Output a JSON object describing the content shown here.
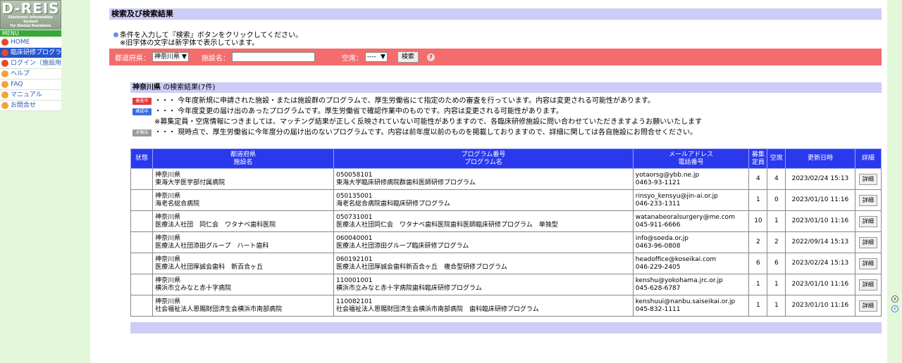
{
  "logo": {
    "title": "D-REIS",
    "subtitle": [
      "Electronic Information",
      "System",
      "for Dental Residents"
    ]
  },
  "menu_label": "MENU",
  "menu": [
    {
      "label": "HOME",
      "icon": "home-icon",
      "color": "#e24b2c"
    },
    {
      "label": "臨床研修プログラム閲覧",
      "icon": "search-icon",
      "color": "#e24b2c"
    },
    {
      "label": "ログイン（施設用）",
      "icon": "login-icon",
      "color": "#e24b2c"
    },
    {
      "label": "ヘルプ",
      "icon": "help-icon",
      "color": "#f2a43a"
    },
    {
      "label": "FAQ",
      "icon": "faq-icon",
      "color": "#f2a43a"
    },
    {
      "label": "マニュアル",
      "icon": "manual-icon",
      "color": "#f2a43a"
    },
    {
      "label": "お問合せ",
      "icon": "contact-icon",
      "color": "#f2a43a"
    }
  ],
  "page_title": "検索及び検索結果",
  "instructions": [
    "条件を入力して『検索』ボタンをクリックしてください。",
    "※旧字体の文字は新字体で表示しています。"
  ],
  "search": {
    "pref_label": "都道府県：",
    "pref_value": "神奈川県",
    "facility_label": "施設名：",
    "facility_value": "",
    "vacancy_label": "空席：",
    "vacancy_value": "----",
    "search_button": "検索",
    "help_icon": "?"
  },
  "result": {
    "pref": "神奈川県",
    "summary": "の検索結果(7件)"
  },
  "legend": [
    {
      "badge": "審査中",
      "color": "#e23a3a",
      "text": "・・・ 今年度新規に申請された施設・または施設群のプログラムで、厚生労働省にて指定のための審査を行っています。内容は変更される可能性があります。"
    },
    {
      "badge": "確認中",
      "color": "#3a6ee2",
      "text": "・・・ 今年度変更の届け出のあったプログラムです。厚生労働省で確認作業中のものです。内容は変更される可能性があります。"
    },
    {
      "badge": "",
      "color": "",
      "text": "※募集定員・空席情報につきましては、マッチング結果が正しく反映されていない可能性がありますので、各臨床研修施設に問い合わせていただきますようお願いいたします"
    },
    {
      "badge": "未報告",
      "color": "#9a9a9a",
      "text": "・・・ 現時点で、厚生労働省に今年度分の届け出のないプログラムです。内容は前年度以前のものを掲載しておりますので、詳細に関しては各自施設にお問合せください。"
    }
  ],
  "table": {
    "headers": {
      "status": "状態",
      "pref_facility": [
        "都道府県",
        "施設名"
      ],
      "program": [
        "プログラム番号",
        "プログラム名"
      ],
      "contact": [
        "メールアドレス",
        "電話番号"
      ],
      "capacity": [
        "募集",
        "定員"
      ],
      "vacancy": "空席",
      "updated": "更新日時",
      "detail": "詳細"
    },
    "rows": [
      {
        "pref": "神奈川県",
        "facility": "東海大学医学部付属病院",
        "program_no": "050058101",
        "program_name": "東海大学臨床研修病院群歯科医師研修プログラム",
        "email": "yotaorsg@ybb.ne.jp",
        "phone": "0463-93-1121",
        "capacity": "4",
        "vacancy": "4",
        "updated": "2023/02/24 15:13",
        "detail": "詳細"
      },
      {
        "pref": "神奈川県",
        "facility": "海老名総合病院",
        "program_no": "050135001",
        "program_name": "海老名総合病院歯科臨床研修プログラム",
        "email": "rinsyo_kensyu@jin-ai.or.jp",
        "phone": "046-233-1311",
        "capacity": "1",
        "vacancy": "0",
        "updated": "2023/01/10 11:16",
        "detail": "詳細"
      },
      {
        "pref": "神奈川県",
        "facility": "医療法人社団　同仁会　ワタナベ歯科医院",
        "program_no": "050731001",
        "program_name": "医療法人社団同仁会　ワタナベ歯科医院歯科医師臨床研修プログラム　単独型",
        "email": "watanabeoralsurgery@me.com",
        "phone": "045-911-6666",
        "capacity": "10",
        "vacancy": "1",
        "updated": "2023/01/10 11:16",
        "detail": "詳細"
      },
      {
        "pref": "神奈川県",
        "facility": "医療法人社団添田グループ　ハート歯科",
        "program_no": "060040001",
        "program_name": "医療法人社団添田グループ臨床研修プログラム",
        "email": "info@soeda.or.jp",
        "phone": "0463-96-0808",
        "capacity": "2",
        "vacancy": "2",
        "updated": "2022/09/14 15:13",
        "detail": "詳細"
      },
      {
        "pref": "神奈川県",
        "facility": "医療法人社団厚誠会歯科　新百合ヶ丘",
        "program_no": "060192101",
        "program_name": "医療法人社団厚誠会歯科新百合ヶ丘　複合型研修プログラム",
        "email": "headoffice@koseikai.com",
        "phone": "046-229-2405",
        "capacity": "6",
        "vacancy": "6",
        "updated": "2023/02/24 15:13",
        "detail": "詳細"
      },
      {
        "pref": "神奈川県",
        "facility": "横浜市立みなと赤十字病院",
        "program_no": "110001001",
        "program_name": "横浜市立みなと赤十字病院歯科臨床研修プログラム",
        "email": "kenshu@yokohama.jrc.or.jp",
        "phone": "045-628-6787",
        "capacity": "1",
        "vacancy": "1",
        "updated": "2023/01/10 11:16",
        "detail": "詳細"
      },
      {
        "pref": "神奈川県",
        "facility": "社会福祉法人恩賜財団済生会横浜市南部病院",
        "program_no": "110082101",
        "program_name": "社会福祉法人恩賜財団済生会横浜市南部病院　歯科臨床研修プログラム",
        "email": "kenshuui@nanbu.saiseikai.or.jp",
        "phone": "045-832-1111",
        "capacity": "1",
        "vacancy": "1",
        "updated": "2023/01/10 11:16",
        "detail": "詳細"
      }
    ]
  },
  "colors": {
    "accent_blue": "#2a39ee",
    "search_red": "#f46c6c",
    "header_lavender": "#ccccf7",
    "sidebar_green": "#e3f7d9"
  }
}
